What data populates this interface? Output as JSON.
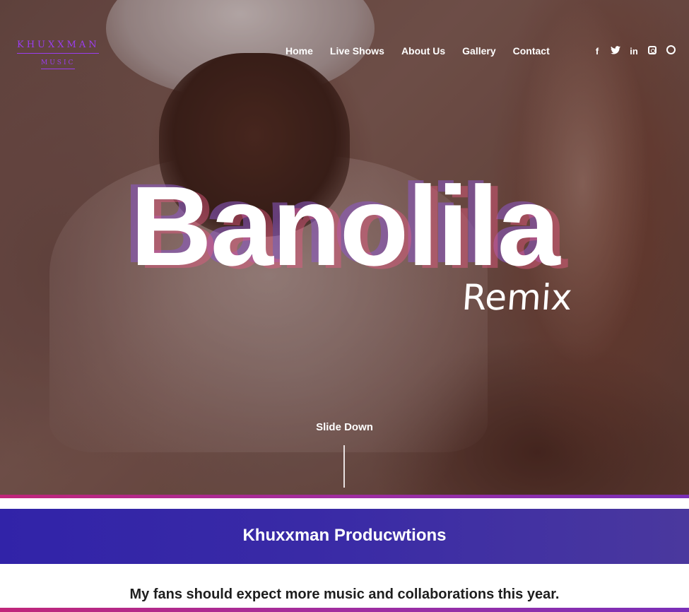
{
  "brand": {
    "name": "KHUXXMAN",
    "sub": "MUSIC",
    "color": "#9b3df0"
  },
  "nav": {
    "items": [
      "Home",
      "Live Shows",
      "About Us",
      "Gallery",
      "Contact"
    ]
  },
  "social": {
    "icons": [
      "facebook-icon",
      "twitter-icon",
      "linkedin-icon",
      "instagram-icon",
      "whatsapp-icon"
    ]
  },
  "hero": {
    "title": "Banolila",
    "subtitle": "Remix",
    "scroll_label": "Slide Down"
  },
  "section": {
    "title": "Khuxxman Producwtions",
    "tagline": "My fans should expect more music and collaborations this year."
  },
  "colors": {
    "band": "#3123a8",
    "accent_stripe": "#c0267a"
  }
}
